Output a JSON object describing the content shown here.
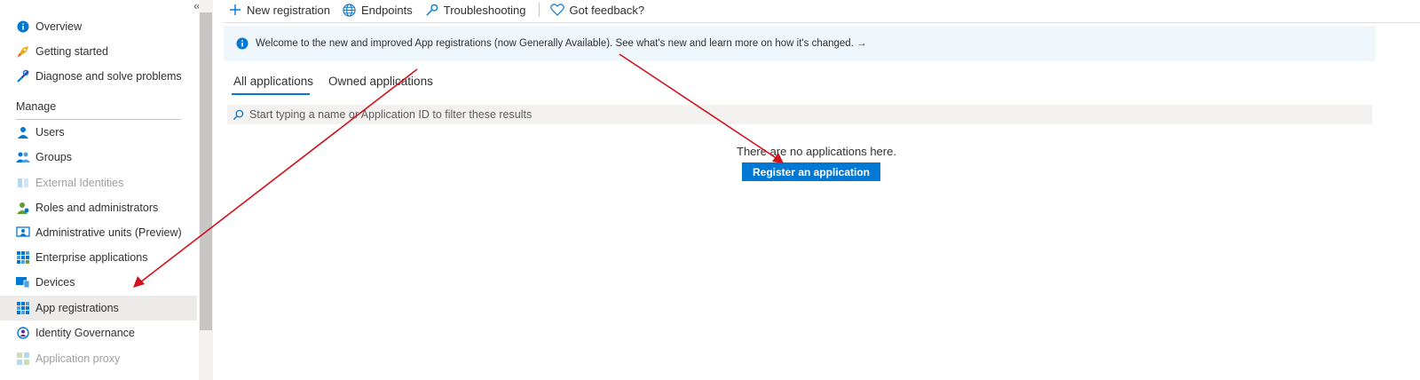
{
  "sidebar": {
    "collapse_label": "«",
    "section_manage": "Manage",
    "items_top": [
      {
        "label": "Overview",
        "icon": "info-icon"
      },
      {
        "label": "Getting started",
        "icon": "rocket-icon"
      },
      {
        "label": "Diagnose and solve problems",
        "icon": "wrench-icon"
      }
    ],
    "items_manage": [
      {
        "label": "Users",
        "icon": "user-icon"
      },
      {
        "label": "Groups",
        "icon": "group-icon"
      },
      {
        "label": "External Identities",
        "icon": "external-identities-icon",
        "disabled": true
      },
      {
        "label": "Roles and administrators",
        "icon": "roles-icon"
      },
      {
        "label": "Administrative units (Preview)",
        "icon": "admin-units-icon"
      },
      {
        "label": "Enterprise applications",
        "icon": "enterprise-apps-icon"
      },
      {
        "label": "Devices",
        "icon": "devices-icon"
      },
      {
        "label": "App registrations",
        "icon": "app-registrations-icon",
        "selected": true
      },
      {
        "label": "Identity Governance",
        "icon": "identity-governance-icon"
      },
      {
        "label": "Application proxy",
        "icon": "app-proxy-icon",
        "disabled": true
      }
    ]
  },
  "toolbar": {
    "new_registration": "New registration",
    "endpoints": "Endpoints",
    "troubleshooting": "Troubleshooting",
    "feedback": "Got feedback?"
  },
  "banner": {
    "text": "Welcome to the new and improved App registrations (now Generally Available). See what's new and learn more on how it's changed. →"
  },
  "tabs": {
    "all": "All applications",
    "owned": "Owned applications"
  },
  "search": {
    "placeholder": "Start typing a name or Application ID to filter these results"
  },
  "empty_state": {
    "message": "There are no applications here.",
    "button": "Register an application"
  },
  "colors": {
    "accent": "#0078d4",
    "selected_bg": "#edebe9",
    "banner_bg": "#eff6fc",
    "annotation_arrow": "#d0121b"
  }
}
